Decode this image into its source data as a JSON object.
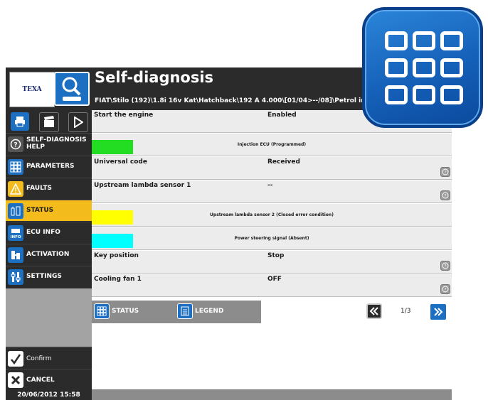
{
  "app": {
    "brand": "TEXA",
    "title": "Self-diagnosis",
    "vehicle_path": "FIAT\\Stilo (192)\\1.8i 16v Kat\\Hatchback\\192 A 4.000\\[01/04>--/08]\\Petrol in",
    "datetime": "20/06/2012 15:58"
  },
  "sidebar": {
    "items": [
      {
        "label": "SELF-DIAGNOSIS HELP",
        "icon": "help-icon"
      },
      {
        "label": "PARAMETERS",
        "icon": "grid-icon"
      },
      {
        "label": "FAULTS",
        "icon": "warning-icon"
      },
      {
        "label": "STATUS",
        "icon": "status-icon"
      },
      {
        "label": "ECU INFO",
        "icon": "info-icon"
      },
      {
        "label": "ACTIVATION",
        "icon": "activation-icon"
      },
      {
        "label": "SETTINGS",
        "icon": "settings-icon"
      }
    ],
    "confirm_label": "Confirm",
    "cancel_label": "CANCEL"
  },
  "rows": [
    {
      "name": "Start the engine",
      "value": "Enabled",
      "info": false
    },
    {
      "bar_label": "Injection ECU (Programmed)",
      "bar_color": "#22dd22",
      "fill": 0.115
    },
    {
      "name": "Universal code",
      "value": "Received",
      "info": true
    },
    {
      "name": "Upstream lambda sensor 1",
      "value": "--",
      "info": true
    },
    {
      "bar_label": "Upstream lambda sensor 2 (Closed error condition)",
      "bar_color": "#ffff00",
      "fill": 0.115
    },
    {
      "bar_label": "Power steering signal (Absent)",
      "bar_color": "#00ffff",
      "fill": 0.115
    },
    {
      "name": "Key position",
      "value": "Stop",
      "info": true
    },
    {
      "name": "Cooling fan 1",
      "value": "OFF",
      "info": true
    }
  ],
  "footer": {
    "status_label": "STATUS",
    "legend_label": "LEGEND",
    "page": "1/3"
  },
  "colors": {
    "accent_blue": "#1d6fc2",
    "active_yellow": "#f4bb1c",
    "dark_bg": "#2b2b2b"
  }
}
